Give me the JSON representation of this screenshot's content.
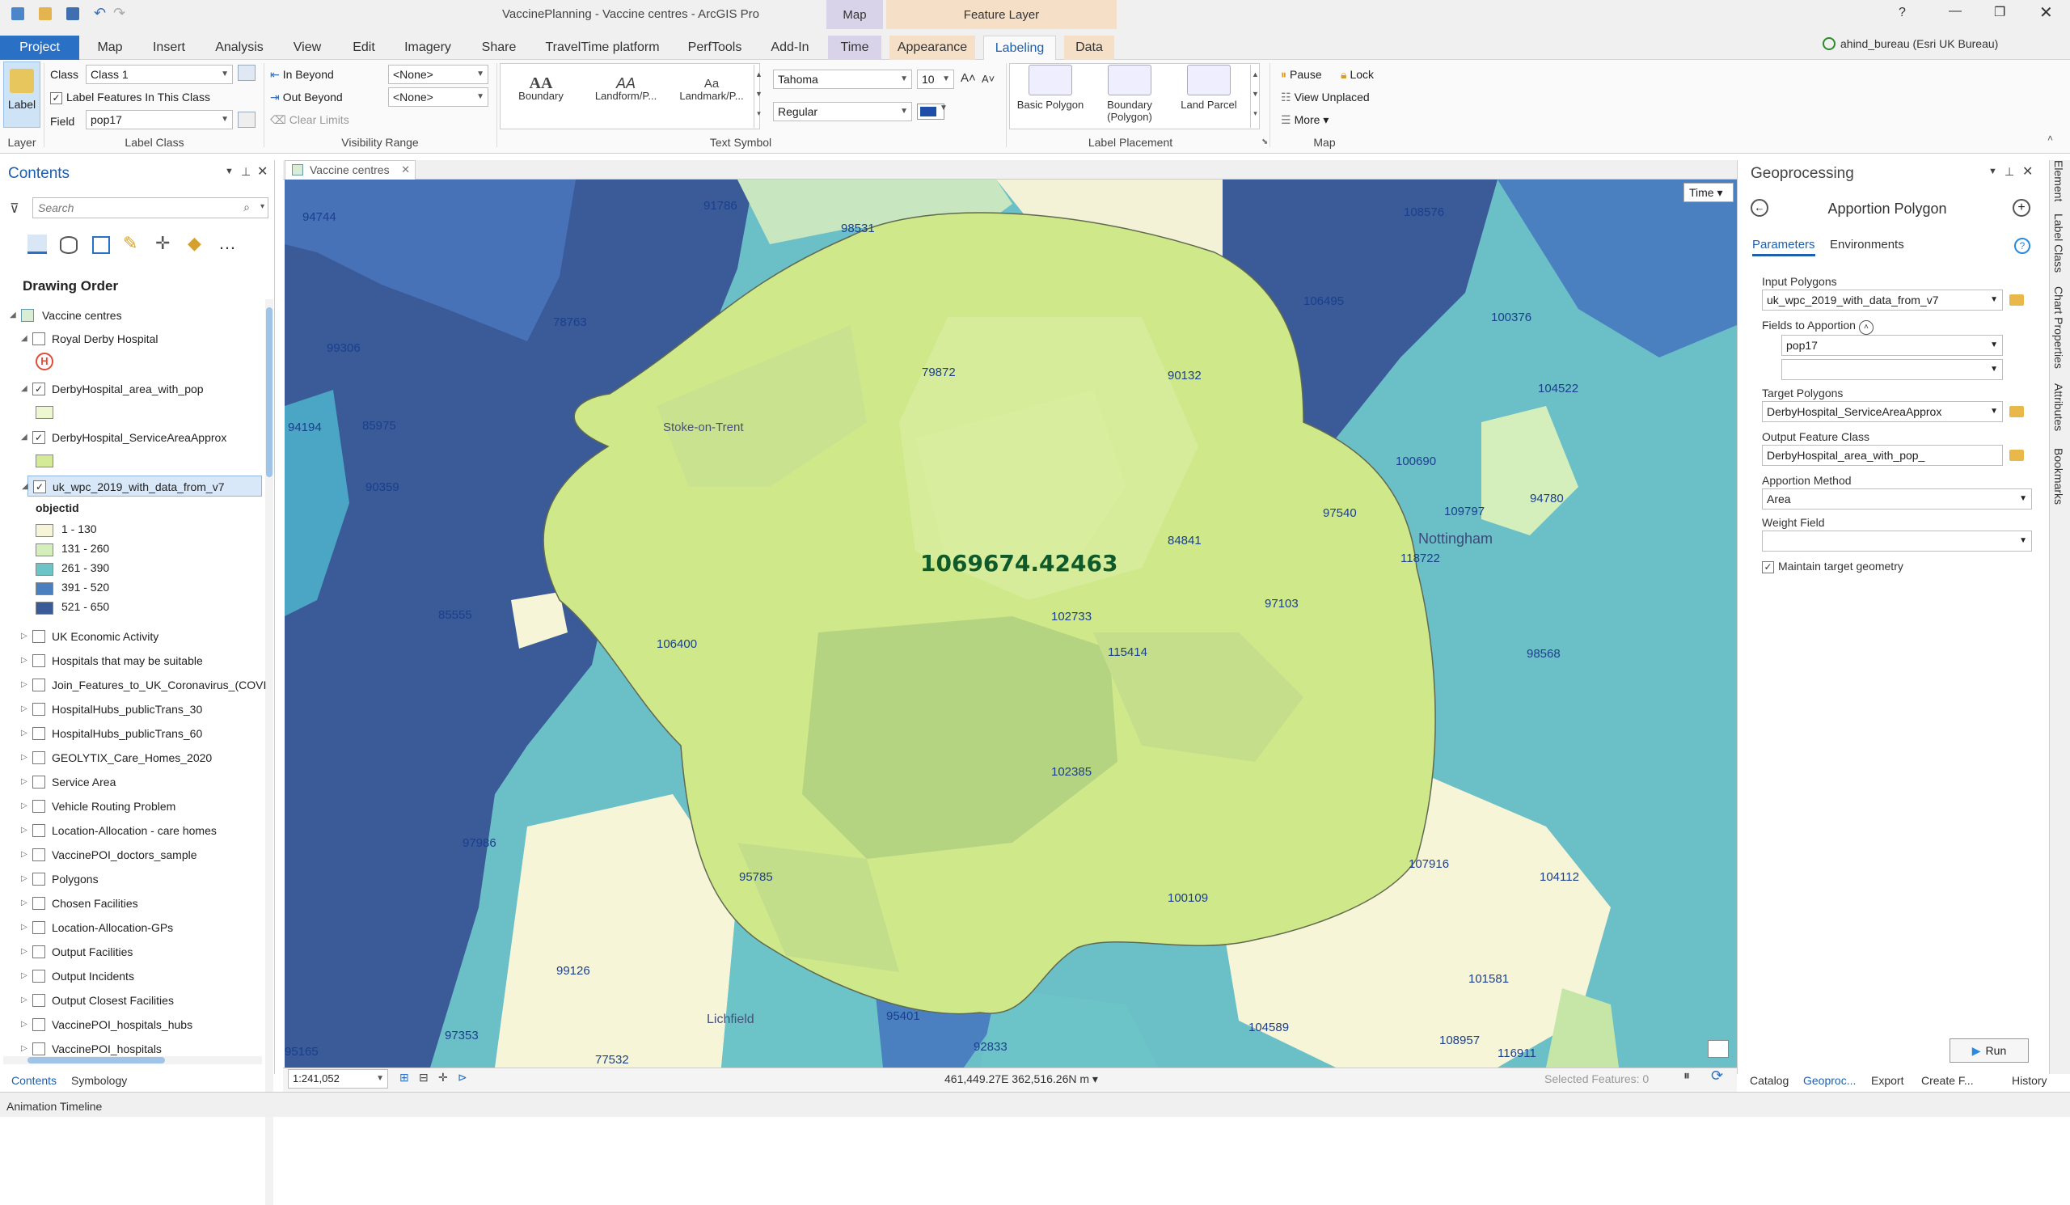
{
  "app": {
    "title": "VaccinePlanning - Vaccine centres - ArcGIS Pro",
    "user": "ahind_bureau (Esri UK Bureau)",
    "help": "?"
  },
  "tabs": [
    "Project",
    "Map",
    "Insert",
    "Analysis",
    "View",
    "Edit",
    "Imagery",
    "Share",
    "TravelTime platform",
    "PerfTools",
    "Add-In",
    "Time",
    "Appearance",
    "Labeling",
    "Data"
  ],
  "context_tabs": {
    "map": "Map",
    "feature_layer": "Feature Layer"
  },
  "ribbon": {
    "layer": {
      "label_btn": "Label",
      "group": "Layer"
    },
    "label_class": {
      "class_label": "Class",
      "class_value": "Class 1",
      "label_features": "Label Features In This Class",
      "field_label": "Field",
      "field_value": "pop17",
      "group": "Label Class"
    },
    "visibility": {
      "in_beyond": "In Beyond",
      "out_beyond": "Out Beyond",
      "none1": "<None>",
      "none2": "<None>",
      "clear_limits": "Clear Limits",
      "group": "Visibility Range"
    },
    "text_symbol": {
      "boundary": "Boundary",
      "landform": "Landform/P...",
      "landmark": "Landmark/P...",
      "font": "Tahoma",
      "size": "10",
      "style": "Regular",
      "color": "#1f4ea8",
      "group": "Text Symbol"
    },
    "placement": {
      "basic": "Basic Polygon",
      "boundary": "Boundary (Polygon)",
      "land": "Land Parcel",
      "group": "Label Placement"
    },
    "map": {
      "pause": "Pause",
      "lock": "Lock",
      "view_unplaced": "View Unplaced",
      "more": "More",
      "group": "Map"
    }
  },
  "contents": {
    "title": "Contents",
    "search_placeholder": "Search",
    "drawing_order": "Drawing Order",
    "map_name": "Vaccine centres",
    "layers": [
      {
        "name": "Royal Derby Hospital",
        "checked": false,
        "expanded": true
      },
      {
        "name": "DerbyHospital_area_with_pop",
        "checked": true,
        "expanded": true
      },
      {
        "name": "DerbyHospital_ServiceAreaApprox",
        "checked": true,
        "expanded": true
      },
      {
        "name": "uk_wpc_2019_with_data_from_v7",
        "checked": true,
        "expanded": true
      }
    ],
    "legend_field": "objectid",
    "legend": [
      {
        "label": "1 - 130",
        "color": "#f7f5d8"
      },
      {
        "label": "131 - 260",
        "color": "#d4eebc"
      },
      {
        "label": "261 - 390",
        "color": "#6cc4c8"
      },
      {
        "label": "391 - 520",
        "color": "#4a80c0"
      },
      {
        "label": "521 - 650",
        "color": "#3a5a98"
      }
    ],
    "other_layers": [
      "UK Economic Activity",
      "Hospitals that may be suitable",
      "Join_Features_to_UK_Coronavirus_(COVI",
      "HospitalHubs_publicTrans_30",
      "HospitalHubs_publicTrans_60",
      "GEOLYTIX_Care_Homes_2020",
      "Service Area",
      "Vehicle Routing Problem",
      "Location-Allocation - care homes",
      "VaccinePOI_doctors_sample",
      "Polygons",
      "Chosen Facilities",
      "Location-Allocation-GPs",
      "Output Facilities",
      "Output Incidents",
      "Output Closest Facilities",
      "VaccinePOI_hospitals_hubs",
      "VaccinePOI_hospitals"
    ],
    "bottom_tabs": [
      "Contents",
      "Symbology"
    ]
  },
  "map": {
    "tab": "Vaccine centres",
    "time_btn": "Time",
    "scale": "1:241,052",
    "coords": "461,449.27E 362,516.26N m",
    "selected": "Selected Features: 0",
    "total_label": "1069674.42463",
    "place_names": [
      "Stoke-on-Trent",
      "Nottingham",
      "Lichfield"
    ],
    "labels": [
      "94744",
      "91786",
      "98531",
      "108576",
      "78763",
      "99306",
      "106495",
      "100376",
      "79872",
      "90132",
      "104522",
      "94194",
      "85975",
      "100690",
      "90359",
      "109797",
      "94780",
      "97540",
      "84841",
      "118722",
      "97103",
      "102733",
      "85555",
      "106400",
      "115414",
      "98568",
      "102385",
      "97986",
      "107916",
      "95785",
      "100109",
      "104112",
      "99126",
      "101581",
      "95401",
      "104589",
      "97353",
      "92833",
      "108957",
      "116911",
      "95165",
      "77532"
    ]
  },
  "geoprocessing": {
    "pane_title": "Geoprocessing",
    "tool": "Apportion Polygon",
    "tabs": [
      "Parameters",
      "Environments"
    ],
    "input_polygons_label": "Input Polygons",
    "input_polygons": "uk_wpc_2019_with_data_from_v7",
    "fields_label": "Fields to Apportion",
    "field1": "pop17",
    "target_label": "Target Polygons",
    "target": "DerbyHospital_ServiceAreaApprox",
    "output_label": "Output Feature Class",
    "output": "DerbyHospital_area_with_pop_",
    "method_label": "Apportion Method",
    "method": "Area",
    "weight_label": "Weight Field",
    "weight": "",
    "maintain": "Maintain target geometry",
    "run": "Run",
    "bottom_tabs": [
      "Catalog",
      "Geoproc...",
      "Export",
      "Create F...",
      "History"
    ]
  },
  "side_tabs": [
    "Element",
    "Label Class",
    "Chart Properties",
    "Attributes",
    "Bookmarks"
  ],
  "status": {
    "animation": "Animation Timeline"
  }
}
